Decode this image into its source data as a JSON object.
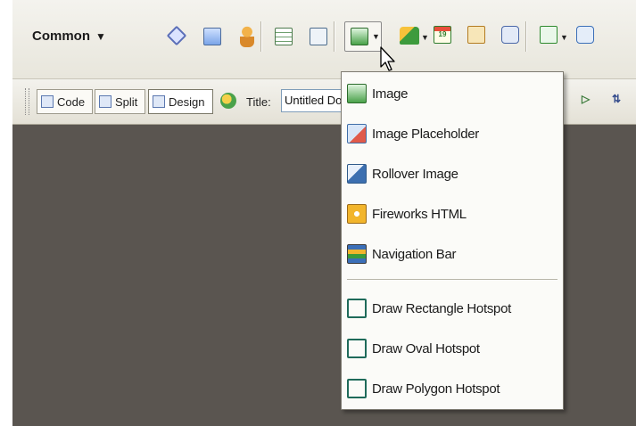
{
  "insert_bar": {
    "category": "Common",
    "category_caret": "▼",
    "calendar_day": "19",
    "icons": [
      "asset-icon",
      "media-icon",
      "person-icon",
      "table-icon",
      "layer-icon",
      "image-icon",
      "paint-icon",
      "calendar-icon",
      "tag-icon",
      "script-icon",
      "page-icon",
      "chat-icon"
    ]
  },
  "doc_toolbar": {
    "views": [
      {
        "label": "Code"
      },
      {
        "label": "Split"
      },
      {
        "label": "Design"
      }
    ],
    "title_label": "Title:",
    "title_value": "Untitled Document",
    "debug_glyph": "▷",
    "sort_glyph": "⇅"
  },
  "image_menu": {
    "items": [
      {
        "label": "Image"
      },
      {
        "label": "Image Placeholder"
      },
      {
        "label": "Rollover Image"
      },
      {
        "label": "Fireworks HTML"
      },
      {
        "label": "Navigation Bar"
      },
      {
        "label": "Draw Rectangle Hotspot"
      },
      {
        "label": "Draw Oval Hotspot"
      },
      {
        "label": "Draw Polygon Hotspot"
      }
    ]
  },
  "colors": {
    "toolbar_bg": "#efede5",
    "document_bg": "#5a5550",
    "menu_bg": "#fbfbf8",
    "hotspot_icon": "#1f6b5a"
  }
}
